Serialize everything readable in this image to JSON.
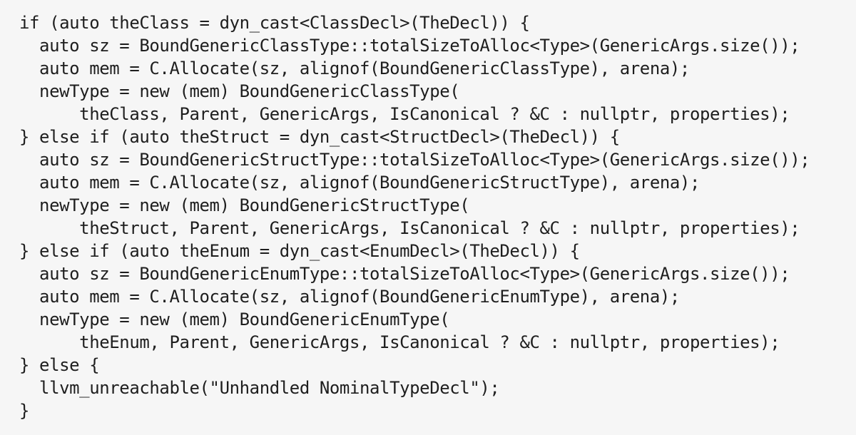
{
  "code": {
    "lines": [
      "if (auto theClass = dyn_cast<ClassDecl>(TheDecl)) {",
      "  auto sz = BoundGenericClassType::totalSizeToAlloc<Type>(GenericArgs.size());",
      "  auto mem = C.Allocate(sz, alignof(BoundGenericClassType), arena);",
      "  newType = new (mem) BoundGenericClassType(",
      "      theClass, Parent, GenericArgs, IsCanonical ? &C : nullptr, properties);",
      "} else if (auto theStruct = dyn_cast<StructDecl>(TheDecl)) {",
      "  auto sz = BoundGenericStructType::totalSizeToAlloc<Type>(GenericArgs.size());",
      "  auto mem = C.Allocate(sz, alignof(BoundGenericStructType), arena);",
      "  newType = new (mem) BoundGenericStructType(",
      "      theStruct, Parent, GenericArgs, IsCanonical ? &C : nullptr, properties);",
      "} else if (auto theEnum = dyn_cast<EnumDecl>(TheDecl)) {",
      "  auto sz = BoundGenericEnumType::totalSizeToAlloc<Type>(GenericArgs.size());",
      "  auto mem = C.Allocate(sz, alignof(BoundGenericEnumType), arena);",
      "  newType = new (mem) BoundGenericEnumType(",
      "      theEnum, Parent, GenericArgs, IsCanonical ? &C : nullptr, properties);",
      "} else {",
      "  llvm_unreachable(\"Unhandled NominalTypeDecl\");",
      "}"
    ]
  }
}
